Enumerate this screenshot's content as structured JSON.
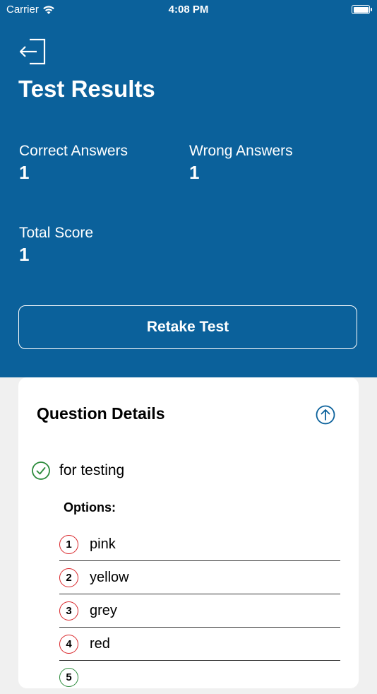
{
  "status_bar": {
    "carrier": "Carrier",
    "time": "4:08 PM"
  },
  "header": {
    "title": "Test Results",
    "correct_label": "Correct Answers",
    "correct_value": "1",
    "wrong_label": "Wrong Answers",
    "wrong_value": "1",
    "total_label": "Total Score",
    "total_value": "1",
    "retake_label": "Retake Test"
  },
  "details": {
    "title": "Question Details",
    "question": "for testing",
    "options_label": "Options:",
    "options": [
      {
        "num": "1",
        "text": "pink"
      },
      {
        "num": "2",
        "text": "yellow"
      },
      {
        "num": "3",
        "text": "grey"
      },
      {
        "num": "4",
        "text": "red"
      },
      {
        "num": "5",
        "text": ""
      }
    ]
  },
  "colors": {
    "header_bg": "#0b619b",
    "correct_green": "#2a8a3a",
    "wrong_red": "#d9262a",
    "accent_blue": "#0b619b"
  }
}
